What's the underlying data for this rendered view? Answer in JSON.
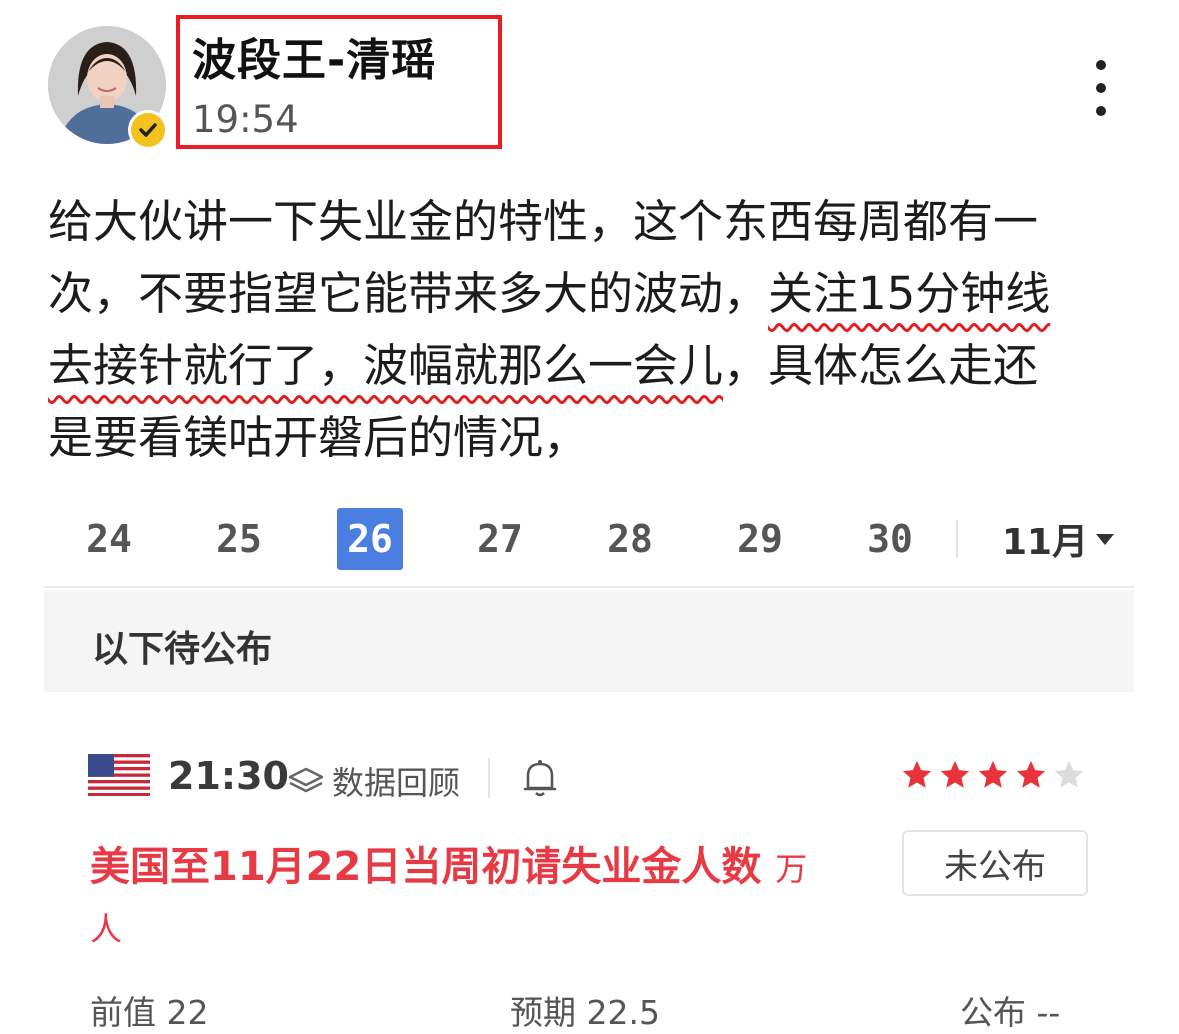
{
  "author": {
    "name": "波段王-清瑶",
    "time": "19:54",
    "avatar_icon": "avatar-photo",
    "verified_icon": "verified-check-icon"
  },
  "post": {
    "lines": [
      {
        "before": "给大伙讲一下失业金的特性，这个东西每周都有一",
        "highlight": "",
        "after": ""
      },
      {
        "before": "次，不要指望它能带来多大的波动，",
        "highlight": "关注15分钟线",
        "after": ""
      },
      {
        "before": "",
        "highlight": "去接针就行了，波幅就那么一会儿",
        "after": "，具体怎么走还"
      },
      {
        "before": "是要看镁咕开磐后的情况，",
        "highlight": "",
        "after": ""
      }
    ],
    "highlight_color": "#e02020"
  },
  "calendar": {
    "dates": [
      "24",
      "25",
      "26",
      "27",
      "28",
      "29",
      "30"
    ],
    "active_date": "26",
    "month": "11月",
    "accent": "#4a7ee0"
  },
  "pending_label": "以下待公布",
  "event": {
    "flag_icon": "us-flag-icon",
    "time": "21:30",
    "review_label": "数据回顾",
    "review_icon": "layers-icon",
    "bell_icon": "bell-icon",
    "stars": 4,
    "stars_max": 5,
    "title": "美国至11月22日当周初请失业金人数",
    "unit_line1": "万",
    "unit_line2": "人",
    "status": "未公布",
    "title_color": "#e63a45",
    "star_color": "#e8333a",
    "stats": {
      "previous": "前值 22",
      "forecast": "预期 22.5",
      "actual": "公布 --"
    }
  }
}
